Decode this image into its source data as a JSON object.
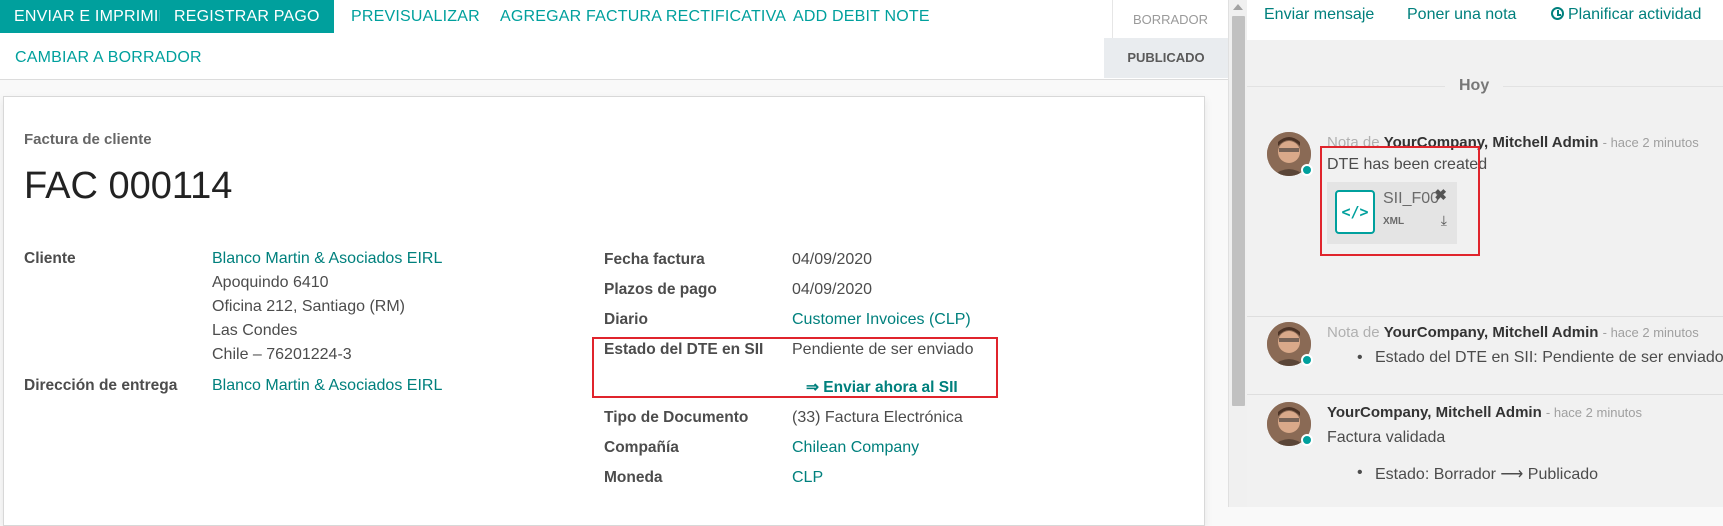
{
  "toolbar": {
    "send_print": "ENVIAR E IMPRIMIR",
    "register_payment": "REGISTRAR PAGO",
    "preview": "PREVISUALIZAR",
    "add_credit_note": "AGREGAR FACTURA RECTIFICATIVA",
    "add_debit_note": "ADD DEBIT NOTE",
    "reset_draft": "CAMBIAR A BORRADOR"
  },
  "statusbar": {
    "draft": "BORRADOR",
    "posted": "PUBLICADO",
    "active": "posted"
  },
  "sheet": {
    "doc_type": "Factura de cliente",
    "doc_name": "FAC 000114",
    "left_fields": {
      "customer_label": "Cliente",
      "customer_name": "Blanco Martin & Asociados EIRL",
      "customer_address": [
        "Apoquindo 6410",
        "Oficina 212, Santiago (RM)",
        "Las Condes",
        "Chile – 76201224-3"
      ],
      "delivery_label": "Dirección de entrega",
      "delivery_value": "Blanco Martin & Asociados EIRL"
    },
    "right_fields": {
      "invoice_date_label": "Fecha factura",
      "invoice_date": "04/09/2020",
      "payment_terms_label": "Plazos de pago",
      "payment_terms": "04/09/2020",
      "journal_label": "Diario",
      "journal": "Customer Invoices (CLP)",
      "dte_state_label": "Estado del DTE en SII",
      "dte_state": "Pendiente de ser enviado",
      "send_now": "⇒ Enviar ahora al SII",
      "doc_type_label": "Tipo de Documento",
      "doc_type_value": "(33) Factura Electrónica",
      "company_label": "Compañía",
      "company": "Chilean Company",
      "currency_label": "Moneda",
      "currency": "CLP"
    }
  },
  "chatter": {
    "send_message": "Enviar mensaje",
    "log_note": "Poner una nota",
    "schedule_activity": "Planificar actividad",
    "day": "Hoy",
    "messages": [
      {
        "prefix": "Nota de",
        "author": "YourCompany, Mitchell Admin",
        "time": "- hace 2 minutos",
        "body": "DTE has been created",
        "attachment": {
          "name": "SII_F00",
          "ext": "XML"
        }
      },
      {
        "prefix": "Nota de",
        "author": "YourCompany, Mitchell Admin",
        "time": "- hace 2 minutos",
        "bullet": "Estado del DTE en SII: Pendiente de ser enviado"
      },
      {
        "author": "YourCompany, Mitchell Admin",
        "time": "- hace 2 minutos",
        "body": "Factura validada",
        "bullet": "Estado: Borrador ⟶ Publicado"
      }
    ]
  },
  "colors": {
    "primary": "#00a09d",
    "link": "#00807d",
    "highlight": "#e0242c"
  }
}
